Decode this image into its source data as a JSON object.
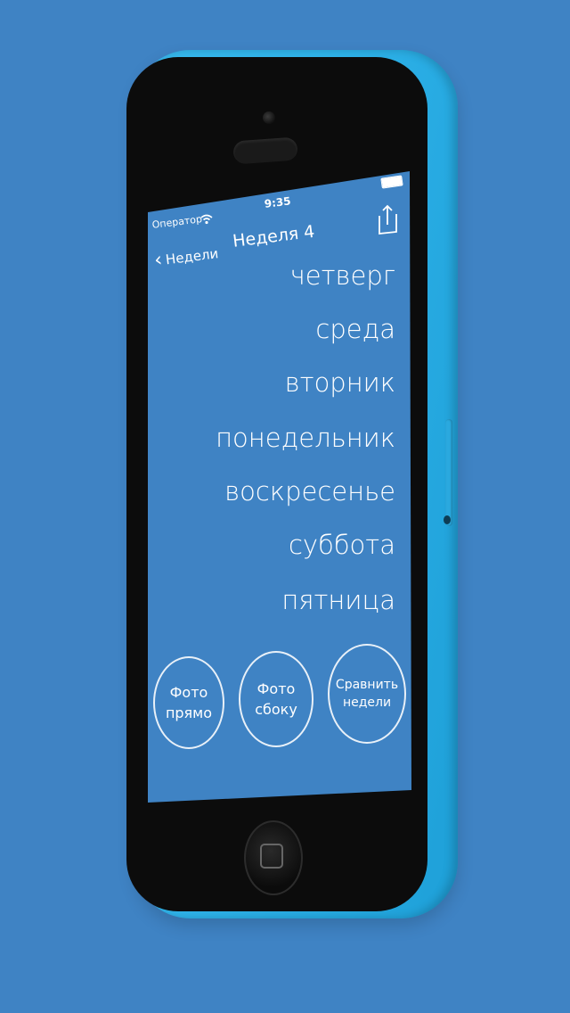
{
  "status_bar": {
    "carrier": "Оператор",
    "time": "9:35"
  },
  "nav": {
    "back_label": "Недели",
    "title": "Неделя 4"
  },
  "days": [
    "четверг",
    "среда",
    "вторник",
    "понедельник",
    "воскресенье",
    "суббота",
    "пятница"
  ],
  "buttons": {
    "photo_front": [
      "Фото",
      "прямо"
    ],
    "photo_side": [
      "Фото",
      "сбоку"
    ],
    "compare_weeks": [
      "Сравнить",
      "недели"
    ]
  },
  "colors": {
    "background": "#3f83c4",
    "phone_body": "#2fb3ea",
    "text": "#ffffff"
  },
  "icons": {
    "wifi": "wifi-icon",
    "battery": "battery-icon",
    "back": "chevron-left-icon",
    "share": "share-icon"
  }
}
